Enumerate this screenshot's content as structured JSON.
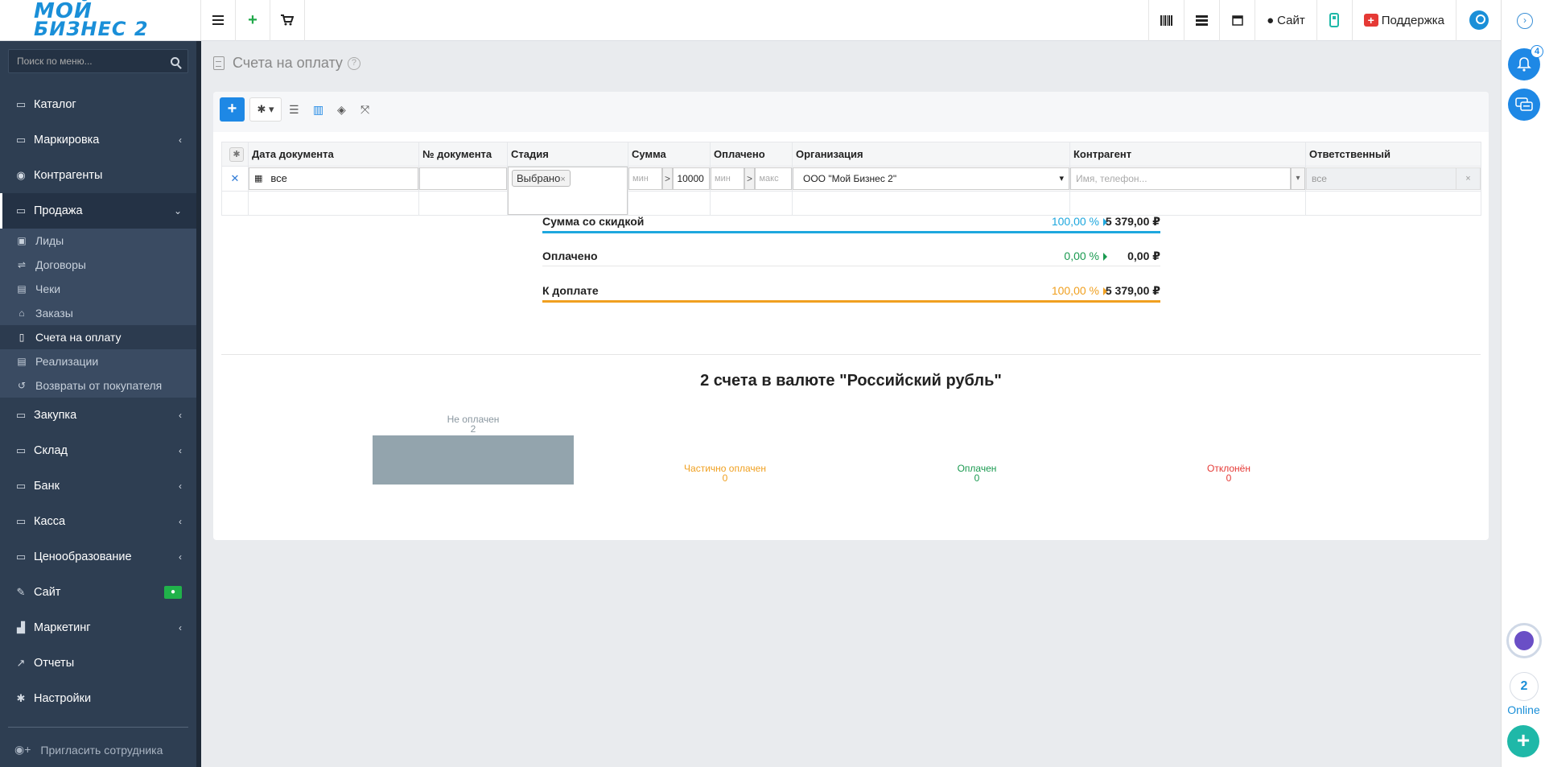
{
  "logo": {
    "line1": "МОЙ",
    "line2": "БИЗНЕС 2"
  },
  "topbar": {
    "site_label": "Сайт",
    "support_label": "Поддержка"
  },
  "sidebar": {
    "search_placeholder": "Поиск по меню...",
    "items": [
      {
        "label": "Каталог",
        "icon": "folder-icon",
        "chevron": false
      },
      {
        "label": "Маркировка",
        "icon": "folder-icon",
        "chevron": true
      },
      {
        "label": "Контрагенты",
        "icon": "users-icon",
        "chevron": false
      },
      {
        "label": "Продажа",
        "icon": "folder-icon",
        "chevron": true,
        "active": true
      }
    ],
    "sub_items": [
      {
        "label": "Лиды",
        "icon": "id-card-icon"
      },
      {
        "label": "Договоры",
        "icon": "handshake-icon"
      },
      {
        "label": "Чеки",
        "icon": "receipt-icon"
      },
      {
        "label": "Заказы",
        "icon": "basket-icon"
      },
      {
        "label": "Счета на оплату",
        "icon": "document-icon",
        "active": true
      },
      {
        "label": "Реализации",
        "icon": "list-icon"
      },
      {
        "label": "Возвраты от покупателя",
        "icon": "undo-icon"
      }
    ],
    "items2": [
      {
        "label": "Закупка",
        "icon": "folder-icon",
        "chevron": true
      },
      {
        "label": "Склад",
        "icon": "folder-icon",
        "chevron": true
      },
      {
        "label": "Банк",
        "icon": "folder-icon",
        "chevron": true
      },
      {
        "label": "Касса",
        "icon": "folder-icon",
        "chevron": true
      },
      {
        "label": "Ценообразование",
        "icon": "folder-icon",
        "chevron": true
      },
      {
        "label": "Сайт",
        "icon": "magic-icon",
        "chevron": false
      },
      {
        "label": "Маркетинг",
        "icon": "chart-icon",
        "chevron": true
      },
      {
        "label": "Отчеты",
        "icon": "line-chart-icon",
        "chevron": false
      },
      {
        "label": "Настройки",
        "icon": "gear-icon",
        "chevron": false
      }
    ],
    "invite_label": "Пригласить сотрудника"
  },
  "page": {
    "title": "Счета на оплату"
  },
  "grid": {
    "headers": [
      "Дата документа",
      "№ документа",
      "Стадия",
      "Сумма",
      "Оплачено",
      "Организация",
      "Контрагент",
      "Ответственный"
    ],
    "filters": {
      "date": "все",
      "stage_chip": "Выбрано",
      "sum_min": "мин",
      "sum_max": "10000",
      "paid_min": "мин",
      "paid_max": "макс",
      "org": "ООО \"Мой Бизнес 2\"",
      "contractor_placeholder": "Имя, телефон...",
      "responsible": "все"
    }
  },
  "summary": [
    {
      "name": "Сумма со скидкой",
      "pct": "100,00 %",
      "amount": "5 379,00 ₽",
      "color": "#1ea7de"
    },
    {
      "name": "Оплачено",
      "pct": "0,00 %",
      "amount": "0,00 ₽",
      "color": "#e0e0e0",
      "pct_color": "#1a9a50"
    },
    {
      "name": "К доплате",
      "pct": "100,00 %",
      "amount": "5 379,00 ₽",
      "color": "#f0a020"
    }
  ],
  "chart_title": "2 счета в валюте \"Российский рубль\"",
  "chart_data": {
    "type": "bar",
    "title": "2 счета в валюте \"Российский рубль\"",
    "categories": [
      "Не оплачен",
      "Частично оплачен",
      "Оплачен",
      "Отклонён"
    ],
    "values": [
      2,
      0,
      0,
      0
    ],
    "label_colors": [
      "#8a97a0",
      "#f0a020",
      "#1a9a50",
      "#e53935"
    ],
    "bar_color": "#93a4ad",
    "ylim": [
      0,
      2
    ]
  }
}
